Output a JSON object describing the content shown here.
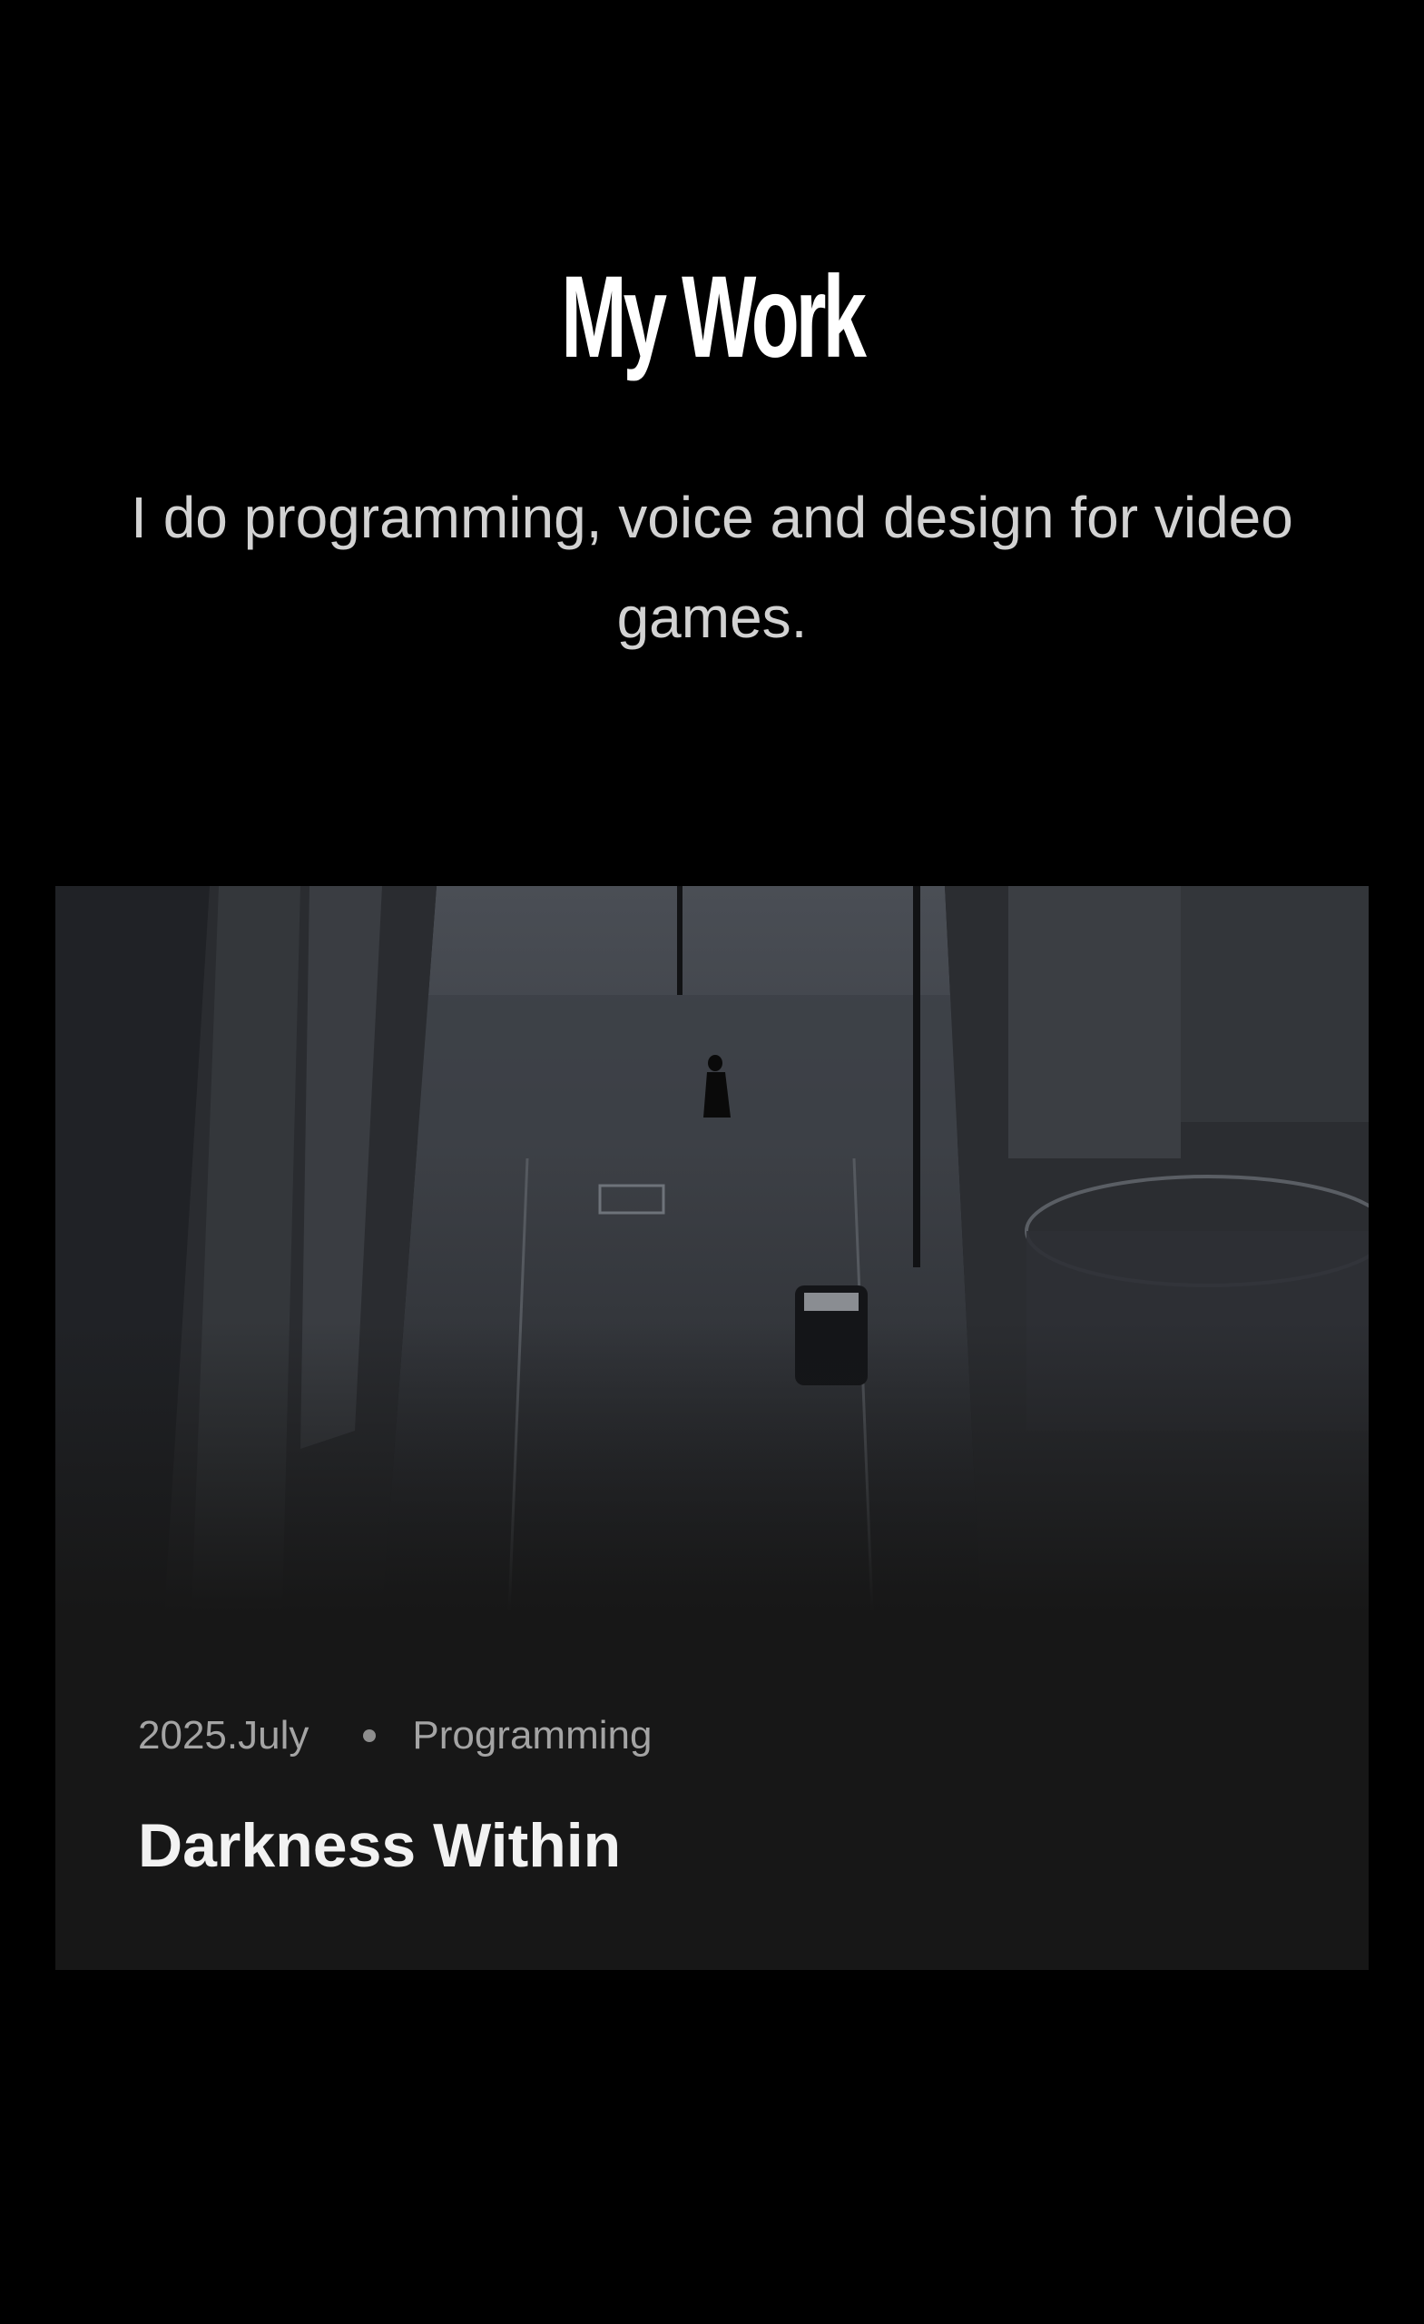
{
  "header": {
    "title": "My Work",
    "subtitle": "I do programming, voice and design for video games."
  },
  "projects": [
    {
      "date": "2025.July",
      "category": "Programming",
      "title": "Darkness Within",
      "image_icon": "night-street-photo"
    }
  ],
  "colors": {
    "background": "#000000",
    "card_background": "#171717",
    "title": "#ffffff",
    "subtitle": "#d2d2d2",
    "meta": "#a4a4a4"
  }
}
